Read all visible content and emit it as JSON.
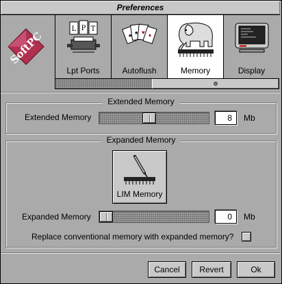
{
  "window": {
    "title": "Preferences"
  },
  "logo": {
    "text": "SoftPC"
  },
  "toolbar": {
    "items": [
      {
        "label": "Lpt Ports",
        "icon": "printer-icon",
        "selected": false
      },
      {
        "label": "Autoflush",
        "icon": "cards-icon",
        "selected": false
      },
      {
        "label": "Memory",
        "icon": "elephant-chip-icon",
        "selected": true
      },
      {
        "label": "Display",
        "icon": "monitor-icon",
        "selected": false
      }
    ]
  },
  "extended": {
    "title": "Extended Memory",
    "label": "Extended Memory",
    "value": "8",
    "unit": "Mb",
    "slider_fraction": 0.45
  },
  "expanded": {
    "title": "Expanded Memory",
    "lim_label": "LIM Memory",
    "label": "Expanded Memory",
    "value": "0",
    "unit": "Mb",
    "slider_fraction": 0.0,
    "replace_label": "Replace conventional memory with expanded memory?",
    "replace_checked": false
  },
  "buttons": {
    "cancel": "Cancel",
    "revert": "Revert",
    "ok": "Ok"
  }
}
